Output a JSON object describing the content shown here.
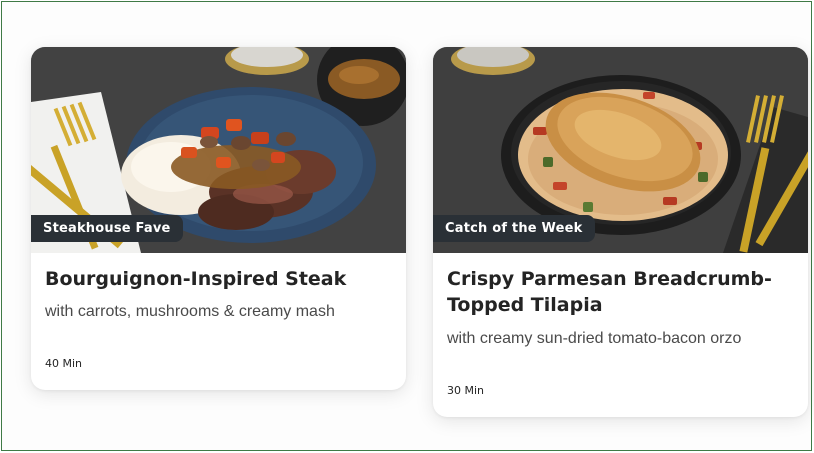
{
  "recipes": [
    {
      "badge": "Steakhouse Fave",
      "title": "Bourguignon-Inspired Steak",
      "subtitle": "with carrots, mushrooms & creamy mash",
      "time": "40 Min"
    },
    {
      "badge": "Catch of the Week",
      "title": "Crispy Parmesan Breadcrumb-Topped Tilapia",
      "subtitle": "with creamy sun-dried tomato-bacon orzo",
      "time": "30 Min"
    }
  ],
  "colors": {
    "badge_bg": "#2a3036",
    "frame_border": "#3f7a46",
    "card_bg": "#ffffff"
  }
}
